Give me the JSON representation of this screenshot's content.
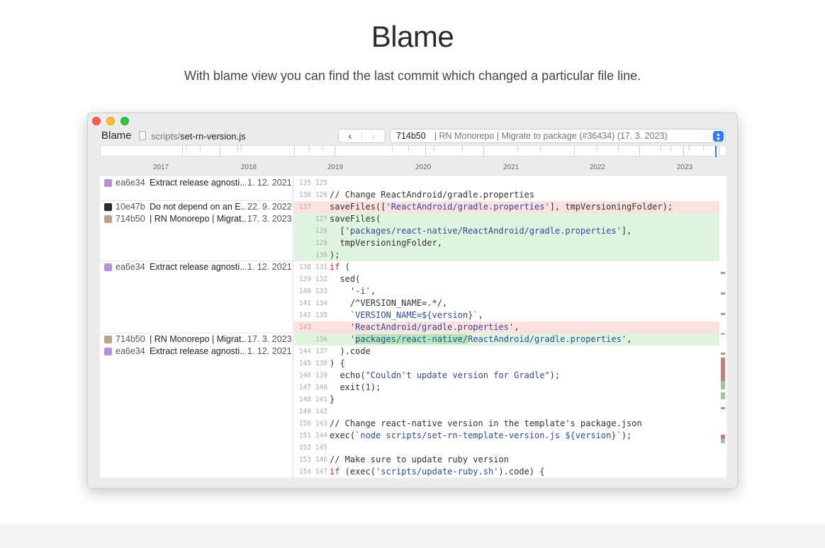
{
  "hero": {
    "title": "Blame",
    "subtitle": "With blame view you can find the last commit which changed a particular file line."
  },
  "window": {
    "title": "Blame",
    "path_dir": "scripts/",
    "path_file": "set-rn-version.js",
    "nav_back": "‹",
    "nav_forward": "›",
    "selected_commit": {
      "hash": "714b50",
      "message": "| RN Monorepo | Migrate to package (#36434) (17. 3. 2023)"
    }
  },
  "timeline": {
    "years": [
      "2017",
      "2018",
      "2019",
      "2020",
      "2021",
      "2022",
      "2023"
    ]
  },
  "blame": [
    {
      "hash": "ea6e34",
      "message": "Extract release agnosti...",
      "date": "1. 12. 2021",
      "avatar": "purple"
    },
    {
      "hash": "10e47b",
      "message": "Do not depend on an E...",
      "date": "22. 9. 2022",
      "avatar": "dark"
    },
    {
      "hash": "714b50",
      "message": "| RN Monorepo | Migrat...",
      "date": "17. 3. 2023",
      "avatar": "photo"
    },
    {
      "hash": "ea6e34",
      "message": "Extract release agnosti...",
      "date": "1. 12. 2021",
      "avatar": "purple"
    },
    {
      "hash": "714b50",
      "message": "| RN Monorepo | Migrat...",
      "date": "17. 3. 2023",
      "avatar": "photo"
    },
    {
      "hash": "ea6e34",
      "message": "Extract release agnosti...",
      "date": "1. 12. 2021",
      "avatar": "purple"
    }
  ],
  "code": [
    {
      "old": "135",
      "new": "125",
      "type": "ctx",
      "parts": [
        [
          "",
          ""
        ]
      ]
    },
    {
      "old": "136",
      "new": "126",
      "type": "ctx",
      "parts": [
        [
          "cm",
          "// Change ReactAndroid/gradle.properties"
        ]
      ]
    },
    {
      "old": "137",
      "new": "",
      "type": "del",
      "parts": [
        [
          "",
          "saveFiles(["
        ],
        [
          "str",
          "'ReactAndroid/gradle.properties'"
        ],
        [
          "",
          "], tmpVersioningFolder);"
        ]
      ]
    },
    {
      "old": "",
      "new": "127",
      "type": "add",
      "parts": [
        [
          "",
          "saveFiles("
        ]
      ]
    },
    {
      "old": "",
      "new": "128",
      "type": "add",
      "parts": [
        [
          "",
          "  ["
        ],
        [
          "str",
          "'packages/react-native/ReactAndroid/gradle.properties'"
        ],
        [
          "",
          "],"
        ]
      ]
    },
    {
      "old": "",
      "new": "129",
      "type": "add",
      "parts": [
        [
          "",
          "  tmpVersioningFolder,"
        ]
      ]
    },
    {
      "old": "",
      "new": "130",
      "type": "add",
      "parts": [
        [
          "",
          ");"
        ]
      ]
    },
    {
      "old": "138",
      "new": "131",
      "type": "ctx",
      "parts": [
        [
          "kw",
          "if"
        ],
        [
          "",
          " ("
        ]
      ]
    },
    {
      "old": "139",
      "new": "132",
      "type": "ctx",
      "parts": [
        [
          "",
          "  sed("
        ]
      ]
    },
    {
      "old": "140",
      "new": "133",
      "type": "ctx",
      "parts": [
        [
          "",
          "    "
        ],
        [
          "str",
          "'-i'"
        ],
        [
          "",
          ","
        ]
      ]
    },
    {
      "old": "141",
      "new": "134",
      "type": "ctx",
      "parts": [
        [
          "",
          "    /^VERSION_NAME=.*/,"
        ]
      ]
    },
    {
      "old": "142",
      "new": "135",
      "type": "ctx",
      "parts": [
        [
          "",
          "    "
        ],
        [
          "str",
          "`VERSION_NAME=${version}`"
        ],
        [
          "",
          ","
        ]
      ]
    },
    {
      "old": "143",
      "new": "",
      "type": "del",
      "parts": [
        [
          "",
          "    "
        ],
        [
          "str",
          "'ReactAndroid/gradle.properties'"
        ],
        [
          "",
          ","
        ]
      ]
    },
    {
      "old": "",
      "new": "136",
      "type": "add",
      "parts": [
        [
          "",
          "    "
        ],
        [
          "str",
          "'"
        ],
        [
          "hl",
          "packages/react-native/"
        ],
        [
          "str",
          "ReactAndroid/gradle.properties'"
        ],
        [
          "",
          ","
        ]
      ]
    },
    {
      "old": "144",
      "new": "137",
      "type": "ctx",
      "parts": [
        [
          "",
          "  ).code"
        ]
      ]
    },
    {
      "old": "145",
      "new": "138",
      "type": "ctx",
      "parts": [
        [
          "",
          ") {"
        ]
      ]
    },
    {
      "old": "146",
      "new": "139",
      "type": "ctx",
      "parts": [
        [
          "",
          "  echo("
        ],
        [
          "str",
          "\"Couldn't update version for Gradle\""
        ],
        [
          "",
          ");"
        ]
      ]
    },
    {
      "old": "147",
      "new": "140",
      "type": "ctx",
      "parts": [
        [
          "",
          "  exit("
        ],
        [
          "str",
          "1"
        ],
        [
          "",
          ");"
        ]
      ]
    },
    {
      "old": "148",
      "new": "141",
      "type": "ctx",
      "parts": [
        [
          "",
          "}"
        ]
      ]
    },
    {
      "old": "149",
      "new": "142",
      "type": "ctx",
      "parts": [
        [
          "",
          ""
        ]
      ]
    },
    {
      "old": "150",
      "new": "143",
      "type": "ctx",
      "parts": [
        [
          "cm",
          "// Change react-native version in the template's package.json"
        ]
      ]
    },
    {
      "old": "151",
      "new": "144",
      "type": "ctx",
      "parts": [
        [
          "",
          "exec("
        ],
        [
          "str",
          "`node scripts/set-rn-template-version.js ${version}`"
        ],
        [
          "",
          ");"
        ]
      ]
    },
    {
      "old": "152",
      "new": "145",
      "type": "ctx",
      "parts": [
        [
          "",
          ""
        ]
      ]
    },
    {
      "old": "153",
      "new": "146",
      "type": "ctx",
      "parts": [
        [
          "cm",
          "// Make sure to update ruby version"
        ]
      ]
    },
    {
      "old": "154",
      "new": "147",
      "type": "ctx",
      "parts": [
        [
          "kw",
          "if"
        ],
        [
          "",
          " (exec("
        ],
        [
          "str",
          "'scripts/update-ruby.sh'"
        ],
        [
          "",
          ").code) {"
        ]
      ]
    }
  ],
  "colors": {
    "deleted_bg": "#fde0e0",
    "added_bg": "#dff4df",
    "keyword": "#c2312b",
    "string": "#2d4a9e",
    "accent": "#2d7cf6"
  }
}
